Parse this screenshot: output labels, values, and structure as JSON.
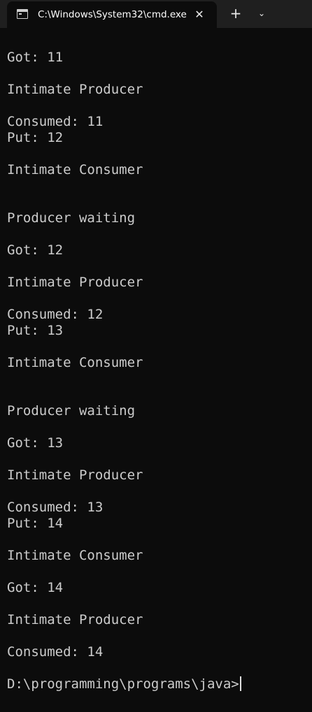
{
  "window": {
    "tab_title": "C:\\Windows\\System32\\cmd.exe",
    "close_glyph": "✕",
    "new_tab_glyph": "+",
    "dropdown_glyph": "⌄"
  },
  "console": {
    "lines": [
      "Got: 11",
      "",
      "Intimate Producer",
      "",
      "Consumed: 11",
      "Put: 12",
      "",
      "Intimate Consumer",
      "",
      "",
      "Producer waiting",
      "",
      "Got: 12",
      "",
      "Intimate Producer",
      "",
      "Consumed: 12",
      "Put: 13",
      "",
      "Intimate Consumer",
      "",
      "",
      "Producer waiting",
      "",
      "Got: 13",
      "",
      "Intimate Producer",
      "",
      "Consumed: 13",
      "Put: 14",
      "",
      "Intimate Consumer",
      "",
      "Got: 14",
      "",
      "Intimate Producer",
      "",
      "Consumed: 14",
      ""
    ],
    "prompt": "D:\\programming\\programs\\java>"
  }
}
